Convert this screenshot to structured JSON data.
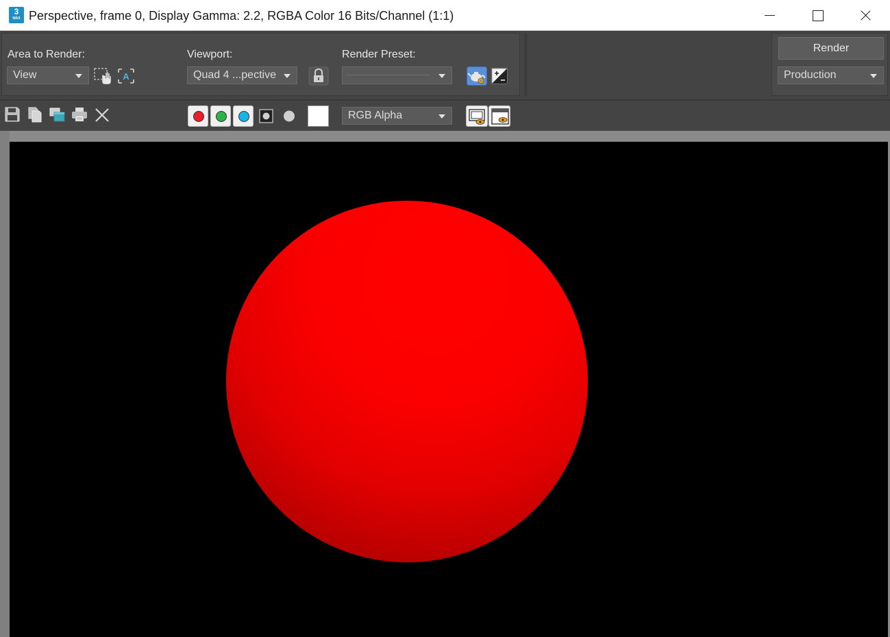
{
  "window": {
    "title": "Perspective, frame 0, Display Gamma: 2.2, RGBA Color 16 Bits/Channel (1:1)",
    "app_icon_text": "3",
    "app_icon_sub": "MAX"
  },
  "controls": {
    "area_label": "Area to Render:",
    "area_value": "View",
    "viewport_label": "Viewport:",
    "viewport_value": "Quad 4 ...pective",
    "preset_label": "Render Preset:",
    "preset_value": "",
    "render_button": "Render",
    "render_mode": "Production"
  },
  "toolbar": {
    "channel_display": "RGB Alpha",
    "channels": [
      {
        "name": "red",
        "color": "#e8202a",
        "active": true
      },
      {
        "name": "green",
        "color": "#2fb04a",
        "active": true
      },
      {
        "name": "blue",
        "color": "#1bb3e6",
        "active": true
      },
      {
        "name": "alpha",
        "color": "#9a9a9a",
        "active": false
      },
      {
        "name": "mono",
        "color": "#cfcfcf",
        "active": false
      }
    ],
    "swatch_color": "#ffffff"
  },
  "render": {
    "background": "#000000",
    "object": "sphere",
    "object_color": "#ff0000"
  }
}
